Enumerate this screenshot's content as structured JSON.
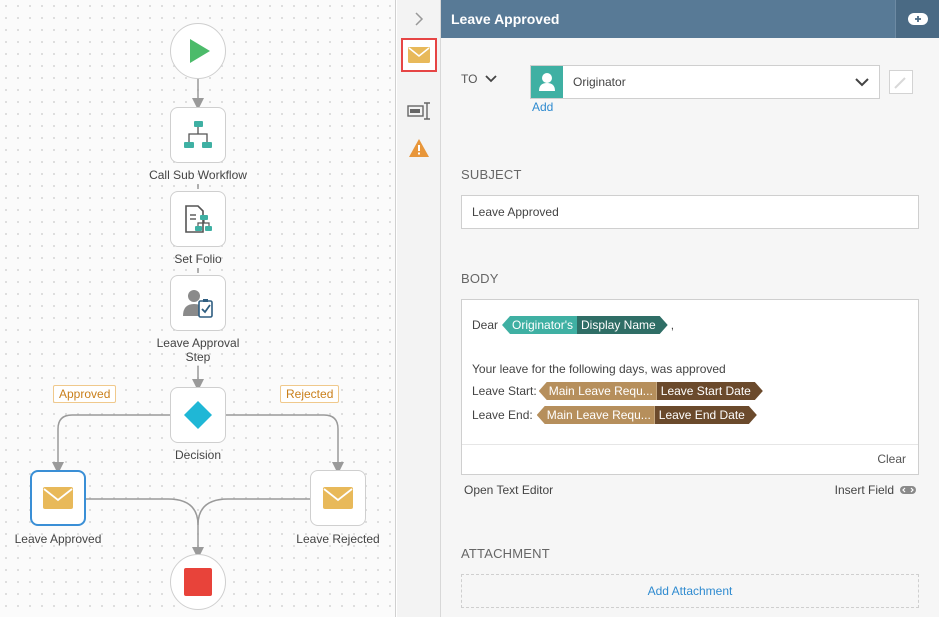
{
  "workflow": {
    "start_node": "start",
    "nodes": {
      "call_sub_workflow": "Call Sub Workflow",
      "set_folio": "Set Folio",
      "leave_approval": "Leave Approval\nStep",
      "decision": "Decision",
      "leave_approved": "Leave Approved",
      "leave_rejected": "Leave Rejected"
    },
    "branches": {
      "approved": "Approved",
      "rejected": "Rejected"
    }
  },
  "panel": {
    "title": "Leave Approved",
    "to_label": "TO",
    "to_value": "Originator",
    "add_link": "Add",
    "subject_title": "SUBJECT",
    "subject_value": "Leave Approved",
    "body_title": "BODY",
    "body": {
      "greeting": "Dear",
      "token_greet_left": "Originator's",
      "token_greet_right": "Display Name",
      "greeting_suffix": ",",
      "line1": "Your leave for the following days, was approved",
      "start_label": "Leave Start:",
      "token_start_left": "Main Leave Requ...",
      "token_start_right": "Leave Start Date",
      "end_label": "Leave End:",
      "token_end_left": "Main Leave Requ...",
      "token_end_right": "Leave End Date",
      "clear_label": "Clear"
    },
    "open_text_editor": "Open Text Editor",
    "insert_field": "Insert Field",
    "attachment_title": "ATTACHMENT",
    "add_attachment": "Add Attachment"
  },
  "colors": {
    "header": "#587a96",
    "accent_link": "#2f8bd0",
    "teal_token": "#3fb0a3",
    "brown_token": "#b68f5c",
    "envelope": "#e8b95a",
    "start_green": "#4cbb6a",
    "stop_red": "#e8433a"
  }
}
